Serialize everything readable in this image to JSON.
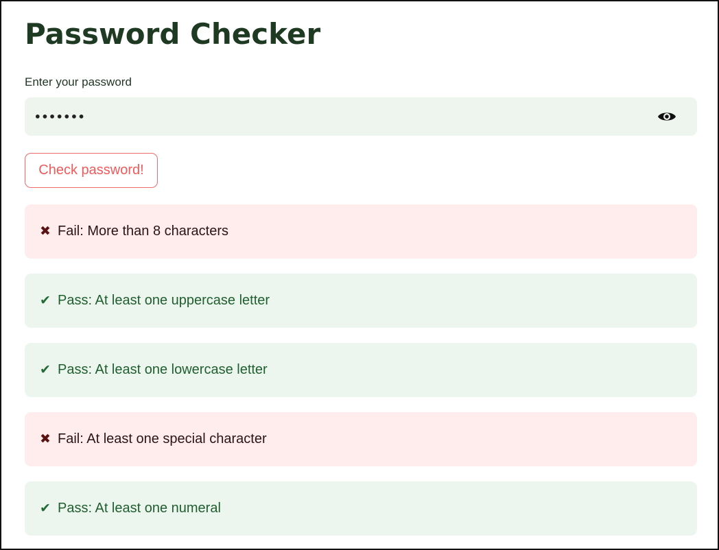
{
  "app": {
    "title": "Password Checker"
  },
  "password_field": {
    "label": "Enter your password",
    "value": "•••••••",
    "visibility_icon": "eye-icon"
  },
  "check_button": {
    "label": "Check password!"
  },
  "results": [
    {
      "status": "fail",
      "icon": "cross-icon",
      "mark": "✖",
      "text": "Fail: More than 8 characters"
    },
    {
      "status": "pass",
      "icon": "check-icon",
      "mark": "✔",
      "text": "Pass: At least one uppercase letter"
    },
    {
      "status": "pass",
      "icon": "check-icon",
      "mark": "✔",
      "text": "Pass: At least one lowercase letter"
    },
    {
      "status": "fail",
      "icon": "cross-icon",
      "mark": "✖",
      "text": "Fail: At least one special character"
    },
    {
      "status": "pass",
      "icon": "check-icon",
      "mark": "✔",
      "text": "Pass: At least one numeral"
    }
  ],
  "colors": {
    "title": "#1e3a22",
    "input_background": "#eef5ee",
    "button_accent": "#f05a5a",
    "fail_background": "#ffecec",
    "pass_background": "#ecf6ee",
    "pass_text": "#1f5e2e"
  }
}
